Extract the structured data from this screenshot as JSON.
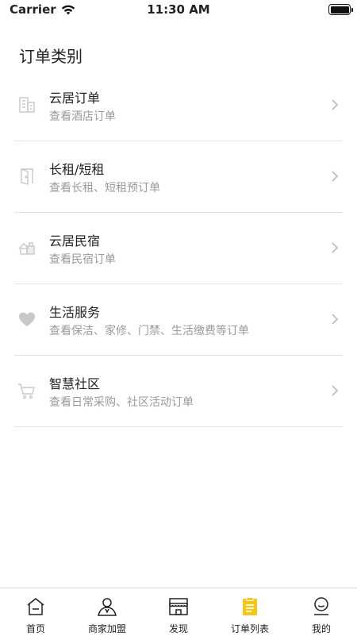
{
  "status_bar": {
    "carrier": "Carrier",
    "time": "11:30 AM",
    "battery_level": 1.0
  },
  "page": {
    "title": "订单类别"
  },
  "categories": [
    {
      "icon": "building-icon",
      "title": "云居订单",
      "subtitle": "查看酒店订单"
    },
    {
      "icon": "door-icon",
      "title": "长租/短租",
      "subtitle": "查看长租、短租预订单"
    },
    {
      "icon": "house-icon",
      "title": "云居民宿",
      "subtitle": "查看民宿订单"
    },
    {
      "icon": "heart-icon",
      "title": "生活服务",
      "subtitle": "查看保洁、家修、门禁、生活缴费等订单"
    },
    {
      "icon": "cart-icon",
      "title": "智慧社区",
      "subtitle": "查看日常采购、社区活动订单"
    }
  ],
  "tab_bar": {
    "active_index": 3,
    "active_color": "#f5c518",
    "items": [
      {
        "icon": "home-icon",
        "label": "首页"
      },
      {
        "icon": "merchant-icon",
        "label": "商家加盟"
      },
      {
        "icon": "store-icon",
        "label": "发现"
      },
      {
        "icon": "order-list-icon",
        "label": "订单列表"
      },
      {
        "icon": "profile-icon",
        "label": "我的"
      }
    ]
  },
  "colors": {
    "icon_gray": "#c8c8c8",
    "subtitle_gray": "#9a9a9a",
    "divider": "#e3e3e3"
  }
}
